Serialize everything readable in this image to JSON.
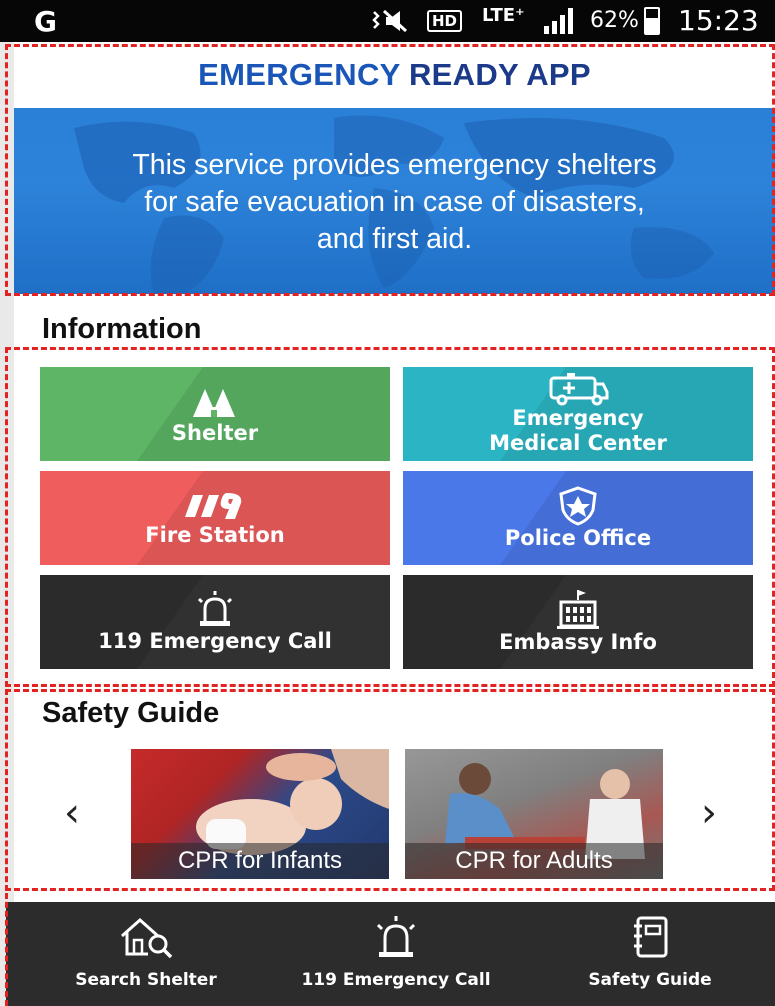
{
  "status_bar": {
    "carrier": "G",
    "signal_icons": "⸻",
    "hd": "HD",
    "network": "LTE⁺",
    "battery_percent": "62%",
    "time": "15:23"
  },
  "header": {
    "title_part1": "EMERGENCY",
    "title_part2": "READY APP"
  },
  "banner": {
    "line1": "This service provides emergency shelters",
    "line2": "for safe evacuation in case of disasters,",
    "line3": "and first aid."
  },
  "information": {
    "title": "Information",
    "tiles": [
      {
        "label": "Shelter",
        "icon": "tent-icon",
        "color": "#5db565"
      },
      {
        "label_line1": "Emergency",
        "label_line2": "Medical Center",
        "icon": "ambulance-icon",
        "color": "#2bb5c4"
      },
      {
        "label": "Fire Station",
        "icon": "fire-119-icon",
        "color": "#ef5d5d"
      },
      {
        "label": "Police Office",
        "icon": "police-badge-icon",
        "color": "#4a78e8"
      },
      {
        "label": "119 Emergency Call",
        "icon": "siren-icon",
        "color": "#2b2b2b"
      },
      {
        "label": "Embassy Info",
        "icon": "embassy-building-icon",
        "color": "#2b2b2b"
      }
    ]
  },
  "safety_guide": {
    "title": "Safety Guide",
    "cards": [
      {
        "caption": "CPR for Infants"
      },
      {
        "caption": "CPR for Adults"
      }
    ],
    "prev_icon": "chevron-left-icon",
    "next_icon": "chevron-right-icon"
  },
  "bottom_nav": [
    {
      "label": "Search Shelter",
      "icon": "search-shelter-icon"
    },
    {
      "label": "119 Emergency Call",
      "icon": "siren-icon"
    },
    {
      "label": "Safety Guide",
      "icon": "notebook-icon"
    }
  ]
}
